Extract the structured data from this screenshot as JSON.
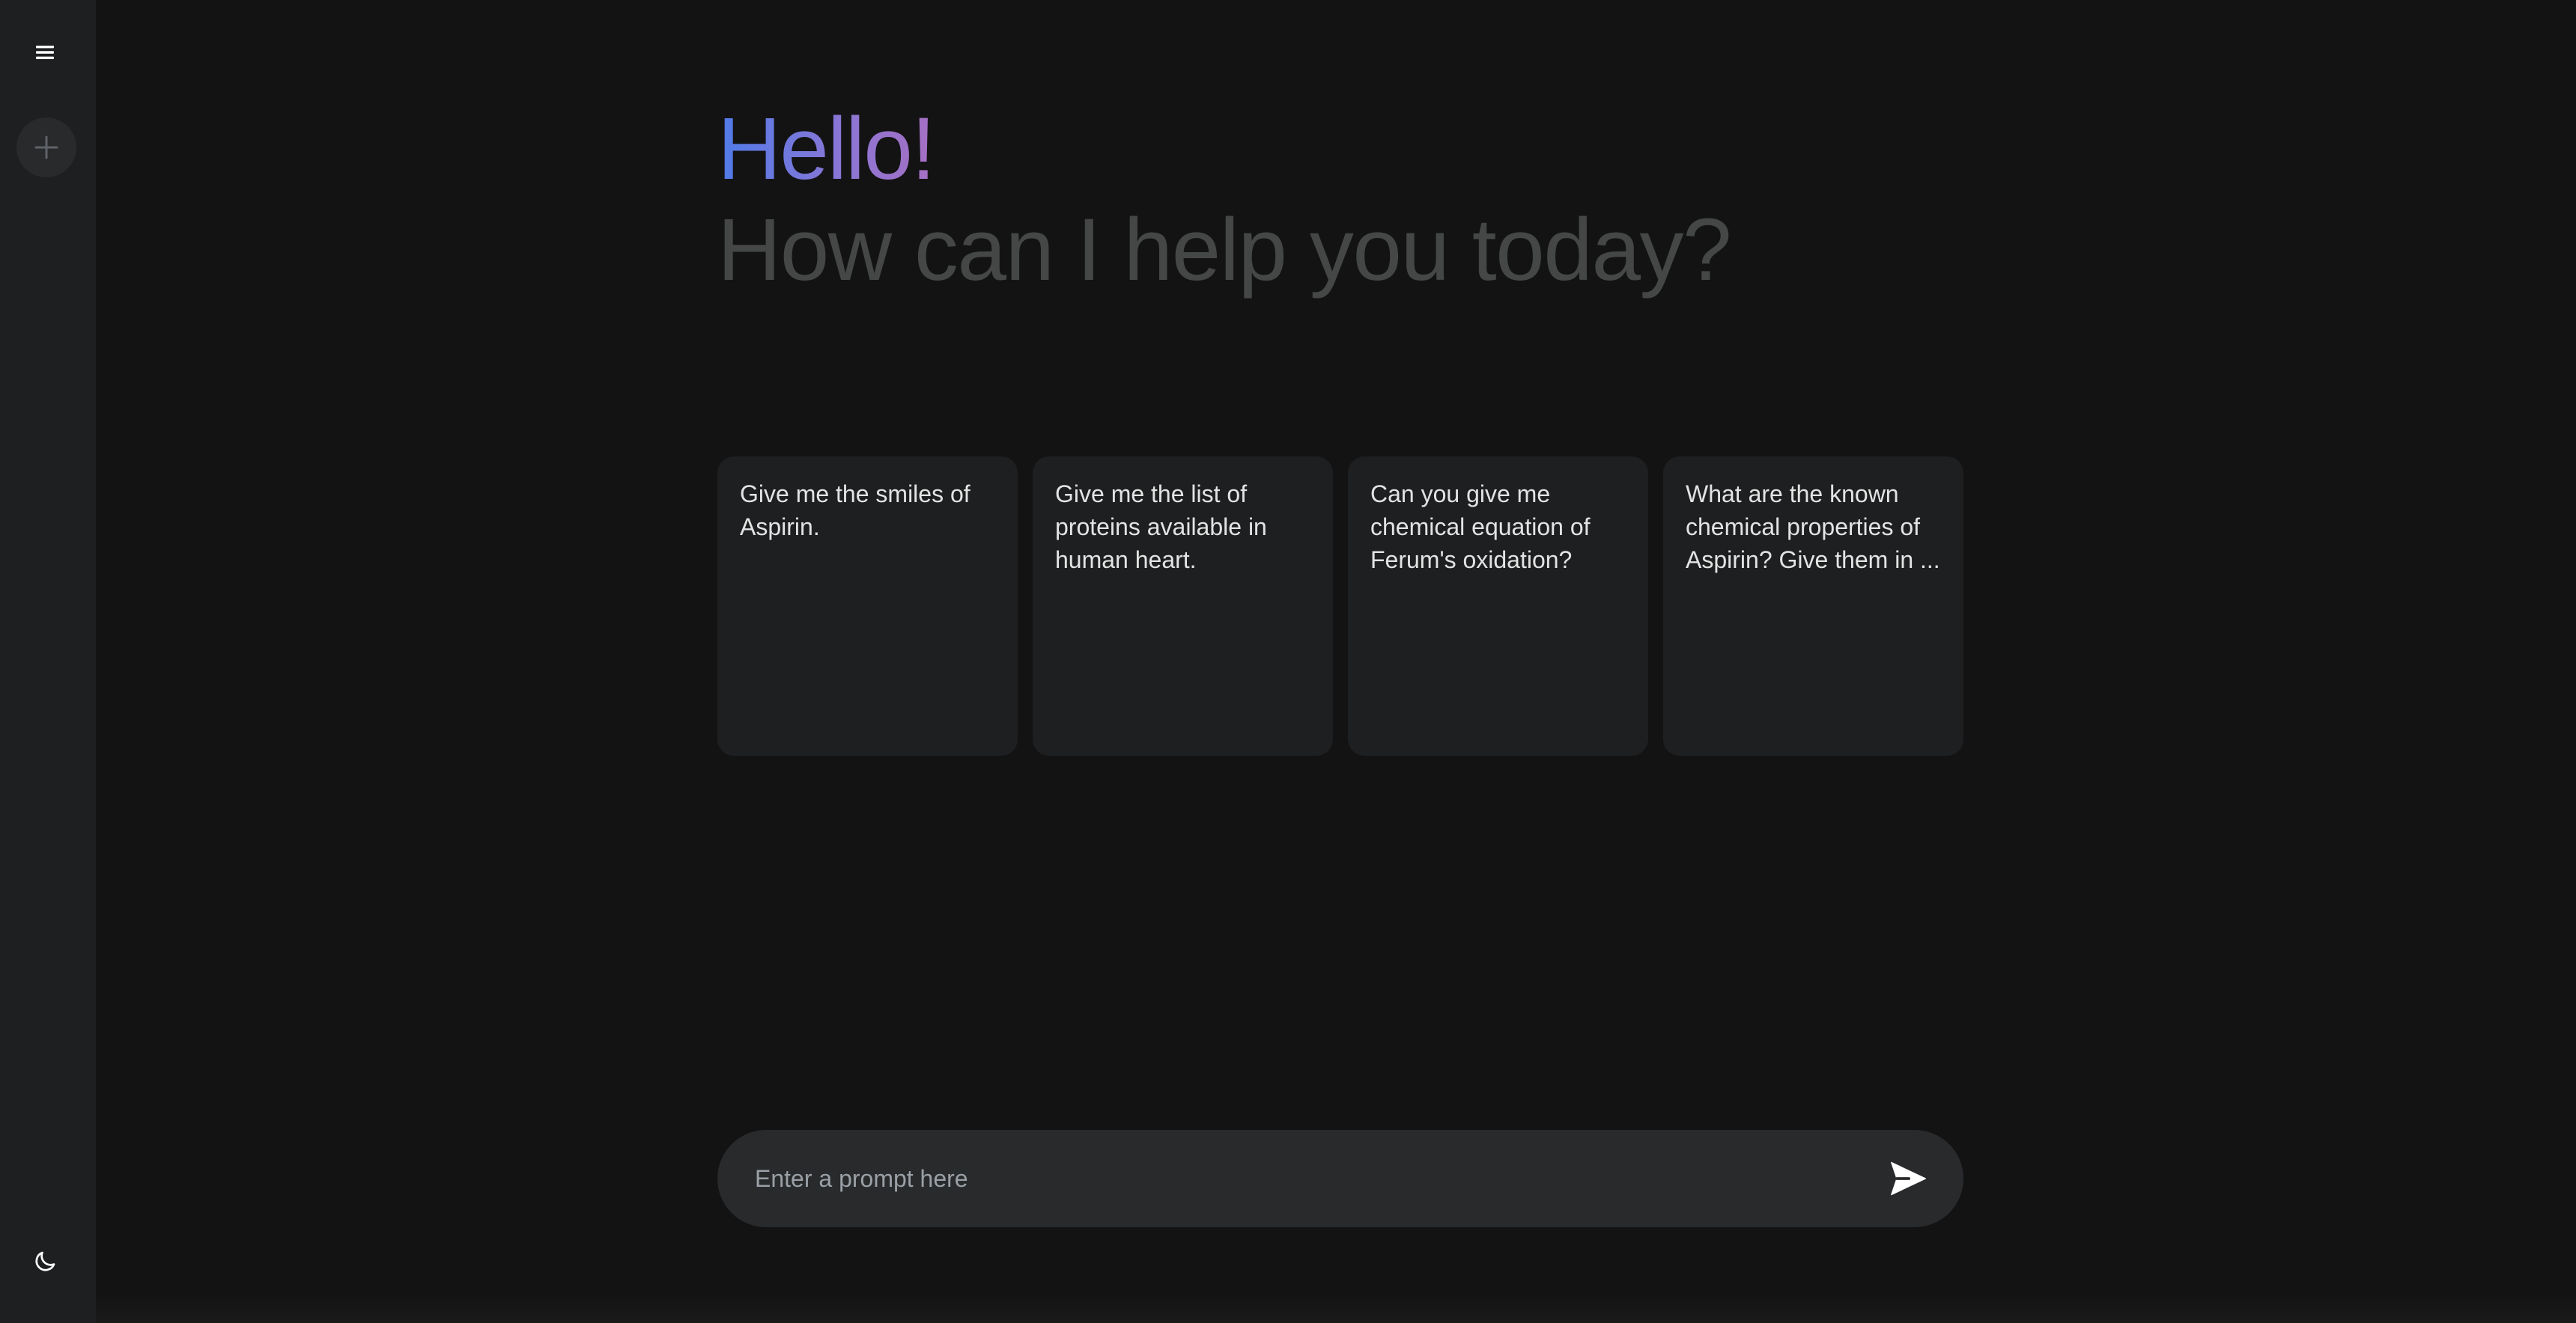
{
  "sidebar": {
    "menu_icon": "hamburger-menu-icon",
    "new_chat_icon": "plus-icon",
    "theme_icon": "moon-icon"
  },
  "greeting": {
    "hello": "Hello!",
    "subtitle": "How can I help you today?"
  },
  "suggestions": [
    {
      "text": "Give me the smiles of Aspirin."
    },
    {
      "text": "Give me the list of proteins available in human heart."
    },
    {
      "text": "Can you give me chemical equation of Ferum's oxidation?"
    },
    {
      "text": "What are the known chemical properties of Aspirin? Give them in ..."
    }
  ],
  "prompt": {
    "placeholder": "Enter a prompt here",
    "send_icon": "send-icon"
  },
  "colors": {
    "background": "#131314",
    "sidebar": "#1e1f20",
    "card": "#1e1f20",
    "input": "#282a2c",
    "gradient_start": "#4f7be8",
    "gradient_end": "#a56fc2",
    "subtitle": "#444746"
  }
}
